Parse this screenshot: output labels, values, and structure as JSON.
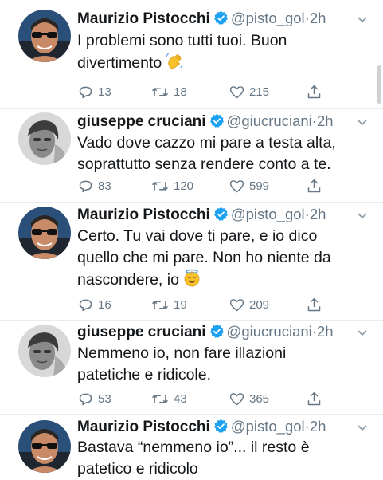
{
  "thread": [
    {
      "author": "Maurizio Pistocchi",
      "handle": "@pisto_gol",
      "separator": "·",
      "time": "2h",
      "avatar": "maurizio-avatar",
      "lines": [
        "I problemi sono tutti tuoi. Buon",
        "divertimento"
      ],
      "emoji": "waving-hand-emoji",
      "replies": "13",
      "retweets": "18",
      "likes": "215"
    },
    {
      "author": "giuseppe cruciani",
      "handle": "@giucruciani",
      "separator": "·",
      "time": "2h",
      "avatar": "giuseppe-avatar",
      "lines": [
        "Vado dove cazzo mi pare a testa alta,",
        "soprattutto senza rendere conto a te."
      ],
      "replies": "83",
      "retweets": "120",
      "likes": "599"
    },
    {
      "author": "Maurizio Pistocchi",
      "handle": "@pisto_gol",
      "separator": "·",
      "time": "2h",
      "avatar": "maurizio-avatar",
      "lines": [
        "Certo. Tu vai dove ti pare, e io dico",
        "quello che mi pare. Non ho niente da",
        "nascondere, io"
      ],
      "emoji": "halo-face-emoji",
      "replies": "16",
      "retweets": "19",
      "likes": "209"
    },
    {
      "author": "giuseppe cruciani",
      "handle": "@giucruciani",
      "separator": "·",
      "time": "2h",
      "avatar": "giuseppe-avatar",
      "lines": [
        "Nemmeno io, non fare illazioni",
        "patetiche e ridicole."
      ],
      "replies": "53",
      "retweets": "43",
      "likes": "365"
    },
    {
      "author": "Maurizio Pistocchi",
      "handle": "@pisto_gol",
      "separator": "·",
      "time": "2h",
      "avatar": "maurizio-avatar",
      "lines": [
        "Bastava “nemmeno io”... il resto è",
        "patetico e ridicolo"
      ]
    }
  ],
  "colors": {
    "text": "#14171a",
    "secondary": "#657786",
    "verified": "#1da1f2",
    "divider": "#e6ecf0"
  }
}
